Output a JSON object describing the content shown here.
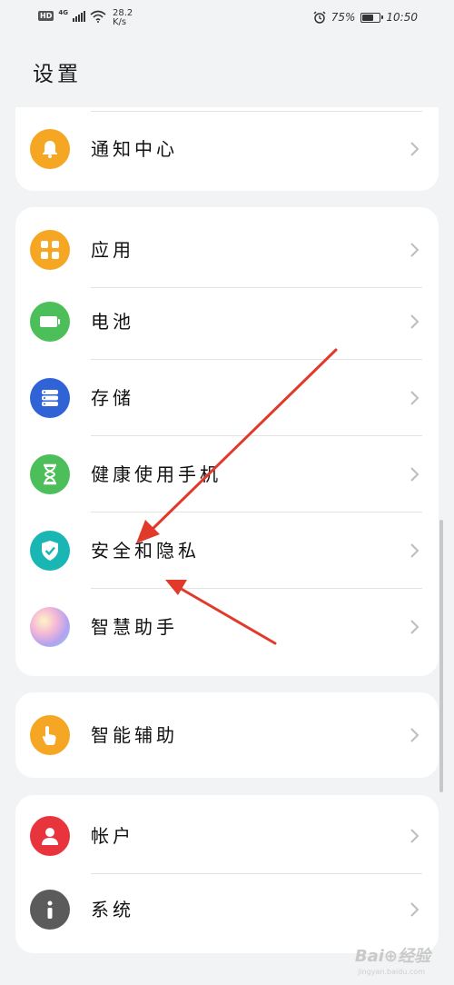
{
  "status_bar": {
    "hd": "HD",
    "network": "4G",
    "speed_value": "28.2",
    "speed_unit": "K/s",
    "battery": "75%",
    "battery_level": 0.75,
    "time": "10:50"
  },
  "page": {
    "title": "设置"
  },
  "groups": [
    {
      "items": [
        {
          "label": "通知中心",
          "icon": "bell-icon",
          "color": "#f5a623"
        }
      ]
    },
    {
      "items": [
        {
          "label": "应用",
          "icon": "apps-grid-icon",
          "color": "#f5a623"
        },
        {
          "label": "电池",
          "icon": "battery-icon",
          "color": "#4cbf5a"
        },
        {
          "label": "存储",
          "icon": "storage-icon",
          "color": "#2f63d6"
        },
        {
          "label": "健康使用手机",
          "icon": "hourglass-icon",
          "color": "#4cbf5a"
        },
        {
          "label": "安全和隐私",
          "icon": "shield-check-icon",
          "color": "#19b6b4"
        },
        {
          "label": "智慧助手",
          "icon": "assistant-gradient-icon",
          "color": "#e9a8d6"
        }
      ]
    },
    {
      "items": [
        {
          "label": "智能辅助",
          "icon": "hand-pointer-icon",
          "color": "#f5a623"
        }
      ]
    },
    {
      "items": [
        {
          "label": "帐户",
          "icon": "user-icon",
          "color": "#e8343c"
        },
        {
          "label": "系统",
          "icon": "info-icon",
          "color": "#5b5b5b"
        }
      ]
    }
  ],
  "watermark": {
    "text": "Bai⊕经验",
    "sub": "jingyan.baidu.com"
  }
}
